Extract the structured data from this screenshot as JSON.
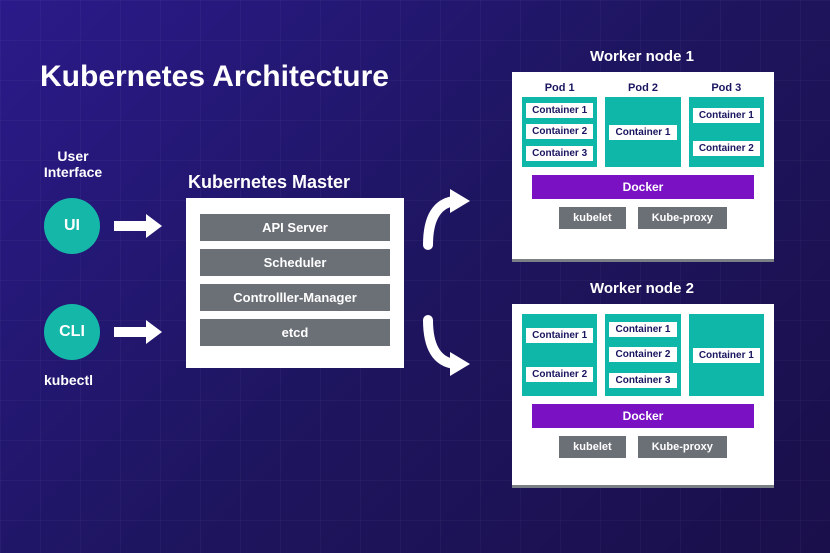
{
  "title": "Kubernetes Architecture",
  "user_interface": {
    "label": "User\nInterface",
    "ui_circle": "UI",
    "cli_circle": "CLI",
    "kubectl": "kubectl"
  },
  "master": {
    "title": "Kubernetes Master",
    "components": [
      "API Server",
      "Scheduler",
      "Controlller-Manager",
      "etcd"
    ]
  },
  "workers": [
    {
      "title": "Worker node 1",
      "pods": [
        {
          "title": "Pod 1",
          "containers": [
            "Container 1",
            "Container 2",
            "Container 3"
          ]
        },
        {
          "title": "Pod 2",
          "containers": [
            "Container 1"
          ]
        },
        {
          "title": "Pod 3",
          "containers": [
            "Container 1",
            "Container 2"
          ]
        }
      ],
      "docker": "Docker",
      "services": [
        "kubelet",
        "Kube-proxy"
      ]
    },
    {
      "title": "Worker node 2",
      "pods": [
        {
          "title": "",
          "containers": [
            "Container 1",
            "Container 2"
          ]
        },
        {
          "title": "",
          "containers": [
            "Container 1",
            "Container 2",
            "Container 3"
          ]
        },
        {
          "title": "",
          "containers": [
            "Container 1"
          ]
        }
      ],
      "docker": "Docker",
      "services": [
        "kubelet",
        "Kube-proxy"
      ]
    }
  ]
}
